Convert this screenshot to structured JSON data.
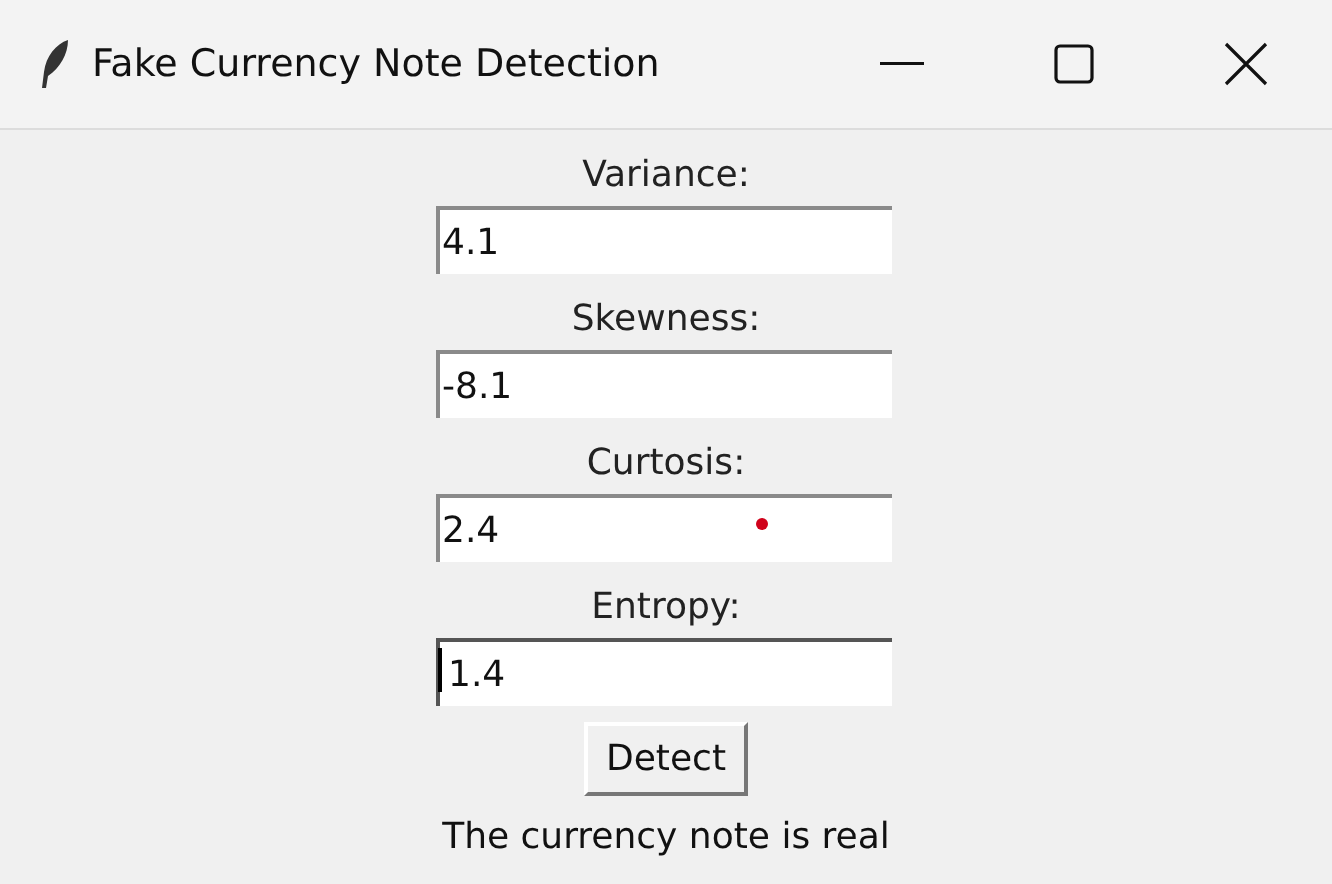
{
  "window": {
    "title": "Fake Currency Note Detection"
  },
  "fields": [
    {
      "label": "Variance:",
      "value": "4.1",
      "focused": false,
      "marker": false
    },
    {
      "label": "Skewness:",
      "value": "-8.1",
      "focused": false,
      "marker": false
    },
    {
      "label": "Curtosis:",
      "value": "2.4",
      "focused": false,
      "marker": true
    },
    {
      "label": "Entropy:",
      "value": "1.4",
      "focused": true,
      "marker": false
    }
  ],
  "button": {
    "label": "Detect"
  },
  "result": "The currency note is real"
}
